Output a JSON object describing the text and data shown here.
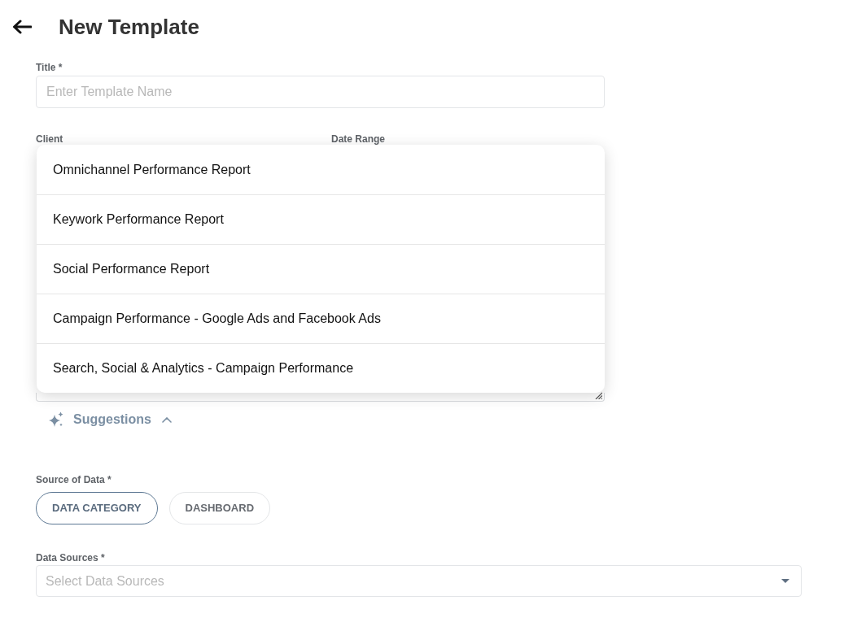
{
  "header": {
    "title": "New Template"
  },
  "fields": {
    "title": {
      "label": "Title *",
      "placeholder": "Enter Template Name"
    },
    "client": {
      "label": "Client"
    },
    "date_range": {
      "label": "Date Range"
    }
  },
  "suggestion_list": {
    "items": [
      "Omnichannel Performance Report",
      "Keywork Performance Report",
      "Social Performance Report",
      "Campaign Performance - Google Ads and Facebook Ads",
      "Search, Social & Analytics - Campaign Performance"
    ]
  },
  "suggestions_toggle": {
    "label": "Suggestions",
    "expanded": true
  },
  "source_of_data": {
    "label": "Source of Data *",
    "options": [
      {
        "label": "DATA CATEGORY",
        "selected": true
      },
      {
        "label": "DASHBOARD",
        "selected": false
      }
    ]
  },
  "data_sources": {
    "label": "Data Sources *",
    "placeholder": "Select Data Sources"
  }
}
